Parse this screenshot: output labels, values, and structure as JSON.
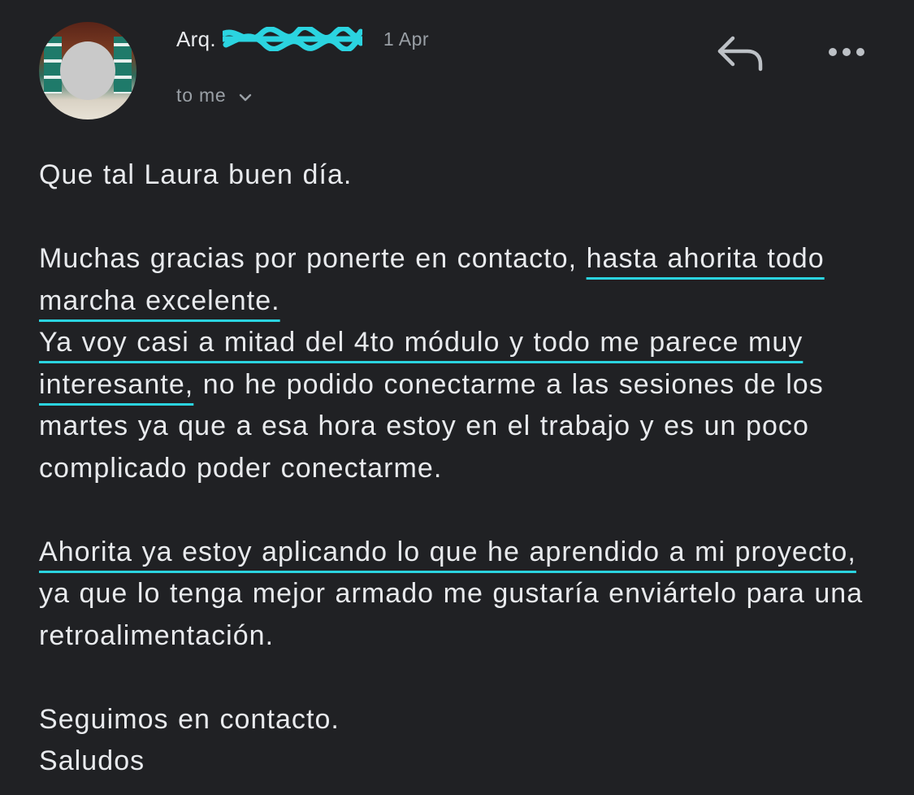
{
  "header": {
    "sender_prefix": "Arq.",
    "date": "1 Apr",
    "recipient": "to me",
    "avatar_icon": "avatar-photo",
    "reply_icon": "reply-icon",
    "more_icon": "more-horizontal-icon",
    "redaction_color": "#2bd4e0"
  },
  "message": {
    "greeting": "Que tal Laura buen día.",
    "p1": {
      "s1_plain": "Muchas gracias por ponerte en contacto,",
      "s1_hl": "hasta ahorita todo marcha excelente."
    },
    "p2": {
      "hl": "Ya voy casi a mitad del 4to módulo y todo me parece muy interesante,",
      "plain": " no he podido conectarme a las sesiones de los martes ya que a esa hora estoy en el trabajo y es un poco complicado poder conectarme."
    },
    "p3": {
      "hl": "Ahorita ya estoy aplicando lo que he aprendido a mi proyecto,",
      "plain": " ya que lo tenga mejor armado me gustaría enviártelo para una retroalimentación."
    },
    "closing1": "Seguimos en contacto.",
    "closing2": "Saludos"
  },
  "colors": {
    "background": "#202124",
    "text": "#e8eaed",
    "secondary_text": "#9aa0a6",
    "highlight_underline": "#2bd4e0"
  }
}
